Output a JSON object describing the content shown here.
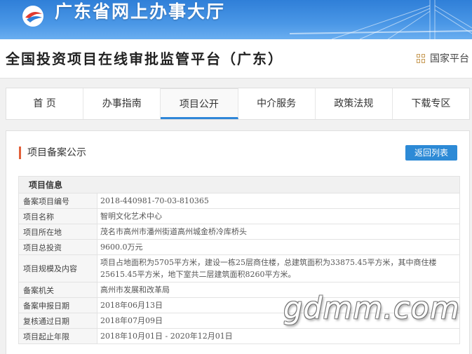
{
  "header": {
    "site_name": "广东省网上办事大厅",
    "platform_title": "全国投资项目在线审批监管平台（广东）",
    "national_link": "国家平台"
  },
  "nav": {
    "items": [
      {
        "label": "首  页"
      },
      {
        "label": "办事指南"
      },
      {
        "label": "项目公开"
      },
      {
        "label": "中介服务"
      },
      {
        "label": "政策法规"
      },
      {
        "label": "下载专区"
      }
    ],
    "active": "项目公开"
  },
  "main": {
    "section_title": "项目备案公示",
    "back_button": "返回列表",
    "table_header": "项目信息",
    "rows": [
      {
        "label": "备案项目编号",
        "value": "2018-440981-70-03-810365"
      },
      {
        "label": "项目名称",
        "value": "智明文化艺术中心"
      },
      {
        "label": "项目所在地",
        "value": "茂名市高州市潘州街道高州城金桥冷库桥头"
      },
      {
        "label": "项目总投资",
        "value": "9600.0万元"
      },
      {
        "label": "项目规模及内容",
        "value": "项目占地面积为5705平方米，建设一栋25层商住楼，总建筑面积为33875.45平方米，其中商住楼25615.45平方米，地下室共二层建筑面积8260平方米。"
      },
      {
        "label": "备案机关",
        "value": "高州市发展和改革局"
      },
      {
        "label": "备案申报日期",
        "value": "2018年06月13日"
      },
      {
        "label": "复核通过日期",
        "value": "2018年07月09日"
      },
      {
        "label": "项目起止年限",
        "value": "2018年10月01日 - 2020年12月01日"
      }
    ]
  },
  "watermark": "gdmm.com",
  "colors": {
    "banner": "#3a8ae0",
    "accent": "#2d8ad6",
    "title_marker": "#e2603a"
  }
}
